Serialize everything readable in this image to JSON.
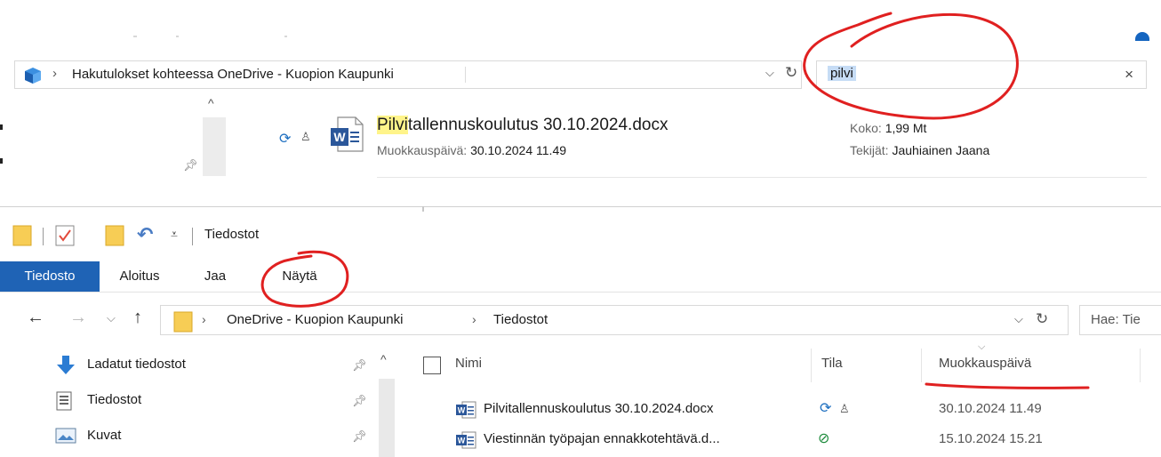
{
  "search_window": {
    "address_path": "Hakutulokset kohteessa OneDrive - Kuopion Kaupunki",
    "search_value": "pilvi",
    "result": {
      "name_highlight": "Pilvi",
      "name_rest": "tallennuskoulutus 30.10.2024.docx",
      "modified_label": "Muokkauspäivä:",
      "modified_value": "30.10.2024 11.49",
      "size_label": "Koko:",
      "size_value": "1,99 Mt",
      "authors_label": "Tekijät:",
      "authors_value": "Jauhiainen Jaana"
    }
  },
  "window": {
    "title": "Tiedostot"
  },
  "ribbon": {
    "tabs": [
      "Tiedosto",
      "Aloitus",
      "Jaa",
      "Näytä"
    ],
    "active_tab": "Tiedosto",
    "accent": "#1f63b5"
  },
  "address": {
    "crumbs": [
      "OneDrive - Kuopion Kaupunki",
      "Tiedostot"
    ],
    "search_placeholder": "Hae: Tie"
  },
  "nav_pane": {
    "items": [
      {
        "label": "Ladatut tiedostot",
        "icon": "download-arrow-icon"
      },
      {
        "label": "Tiedostot",
        "icon": "document-icon"
      },
      {
        "label": "Kuvat",
        "icon": "pictures-icon"
      }
    ]
  },
  "file_list": {
    "columns": [
      "Nimi",
      "Tila",
      "Muokkauspäivä"
    ],
    "sorted_by": "Muokkauspäivä",
    "rows": [
      {
        "name": "Pilvitallennuskoulutus 30.10.2024.docx",
        "status": "syncing-shared",
        "modified": "30.10.2024 11.49"
      },
      {
        "name": "Viestinnän työpajan ennakkotehtävä.d...",
        "status": "available",
        "modified": "15.10.2024 15.21"
      }
    ]
  },
  "colors": {
    "annotation_red": "#e02020",
    "highlight_yellow": "#fff48a",
    "selection_blue": "#c6dcf5"
  }
}
